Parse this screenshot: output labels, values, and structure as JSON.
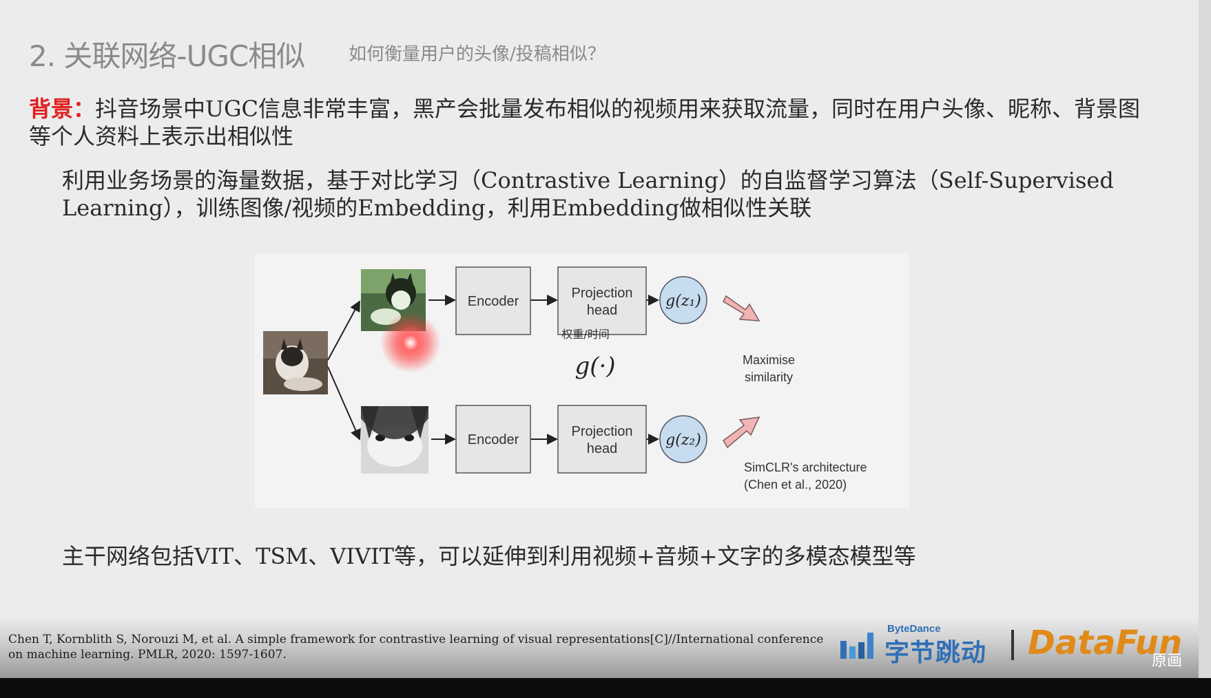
{
  "slide": {
    "title": "2. 关联网络-UGC相似",
    "subtitle": "如何衡量用户的头像/投稿相似？",
    "background_label": "背景：",
    "background_text": "抖音场景中UGC信息非常丰富，黑产会批量发布相似的视频用来获取流量，同时在用户头像、昵称、背景图等个人资料上表示出相似性",
    "method_text": "利用业务场景的海量数据，基于对比学习（Contrastive Learning）的自监督学习算法（Self-Supervised Learning），训练图像/视频的Embedding，利用Embedding做相似性关联",
    "backbone_text": "主干网络包括VIT、TSM、VIVIT等，可以延伸到利用视频+音频+文字的多模态模型等"
  },
  "diagram": {
    "encoder_top": "Encoder",
    "encoder_bottom": "Encoder",
    "proj_top_line1": "Projection",
    "proj_top_line2": "head",
    "proj_bottom_line1": "Projection",
    "proj_bottom_line2": "head",
    "annotation": "权重/时间",
    "g_label": "g(·)",
    "z1_label": "g(z₁)",
    "z2_label": "g(z₂)",
    "maximise_line1": "Maximise",
    "maximise_line2": "similarity",
    "caption_line1": "SimCLR's architecture",
    "caption_line2": "(Chen et al., 2020)"
  },
  "footer": {
    "citation": "Chen T, Kornblith S, Norouzi M, et al. A simple framework for contrastive learning of visual representations[C]//International conference on machine learning. PMLR, 2020: 1597-1607.",
    "bytedance_small": "ByteDance",
    "bytedance_big": "字节跳动",
    "datafun": "DataFun",
    "original_button": "原画"
  },
  "colors": {
    "accent_red": "#e02020",
    "bytedance_blue": "#2f6fb6",
    "datafun_orange": "#e08a1a",
    "node_blue": "#c7dcef",
    "arrow_pink": "#f0b4b4"
  }
}
